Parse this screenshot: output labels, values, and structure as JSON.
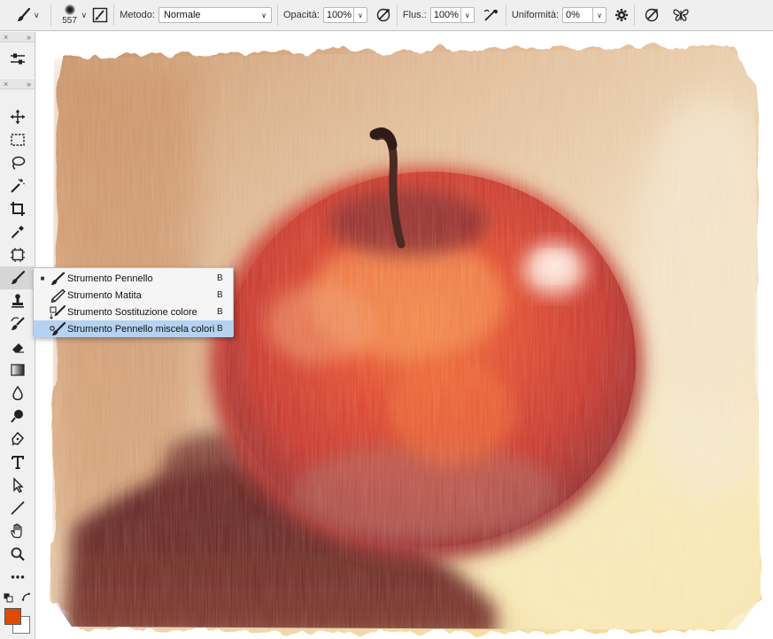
{
  "options_bar": {
    "brush_size": "557",
    "mode_label": "Metodo:",
    "mode_value": "Normale",
    "opacity_label": "Opacità:",
    "opacity_value": "100%",
    "flow_label": "Flus.:",
    "flow_value": "100%",
    "smoothing_label": "Uniformità:",
    "smoothing_value": "0%"
  },
  "panels": {
    "collapse_glyph": "×",
    "expand_glyph": "»"
  },
  "tool_flyout": {
    "items": [
      {
        "label": "Strumento Pennello",
        "shortcut": "B",
        "icon": "brush-icon",
        "active": true,
        "highlighted": false
      },
      {
        "label": "Strumento Matita",
        "shortcut": "B",
        "icon": "pencil-icon",
        "active": false,
        "highlighted": false
      },
      {
        "label": "Strumento Sostituzione colore",
        "shortcut": "B",
        "icon": "color-replacement-icon",
        "active": false,
        "highlighted": false
      },
      {
        "label": "Strumento Pennello miscela colori",
        "shortcut": "B",
        "icon": "mixer-brush-icon",
        "active": false,
        "highlighted": true
      }
    ]
  },
  "colors": {
    "foreground": "#e04a00",
    "background": "#ffffff",
    "highlight": "#b6d2f2"
  },
  "toolbar_tools": [
    "move-icon",
    "marquee-icon",
    "lasso-icon",
    "magic-wand-icon",
    "crop-icon",
    "eyedropper-icon",
    "frame-icon",
    "brush-icon",
    "stamp-icon",
    "history-brush-icon",
    "eraser-icon",
    "gradient-icon",
    "blur-icon",
    "dodge-icon",
    "pen-icon",
    "type-icon",
    "path-select-icon",
    "line-icon",
    "hand-icon",
    "zoom-icon",
    "more-icon"
  ]
}
